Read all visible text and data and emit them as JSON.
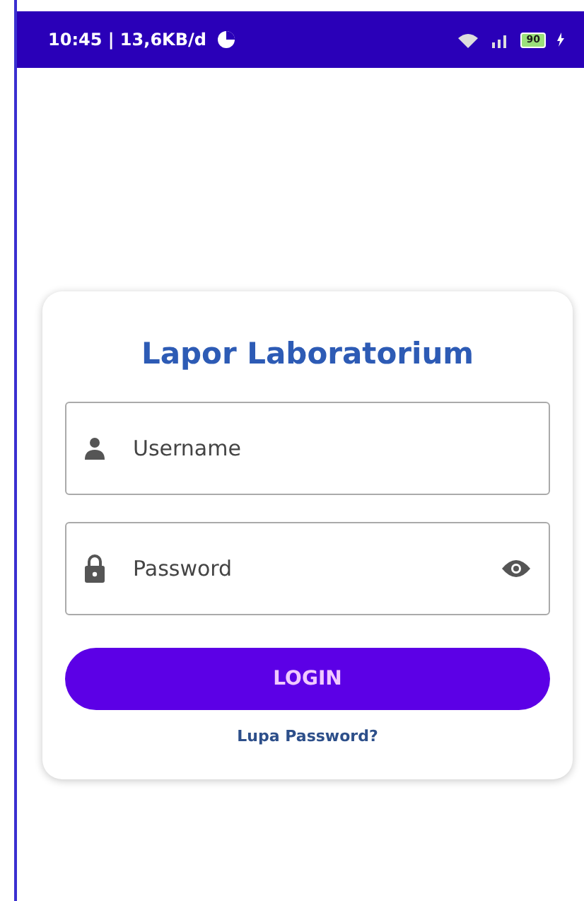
{
  "status_bar": {
    "time_info": "10:45 | 13,6KB/d",
    "battery": "90"
  },
  "login": {
    "title": "Lapor Laboratorium",
    "fields": [
      {
        "kind": "username",
        "placeholder": "Username"
      },
      {
        "kind": "password",
        "placeholder": "Password"
      }
    ],
    "button": "LOGIN",
    "forgot_link": "Lupa Password?"
  }
}
